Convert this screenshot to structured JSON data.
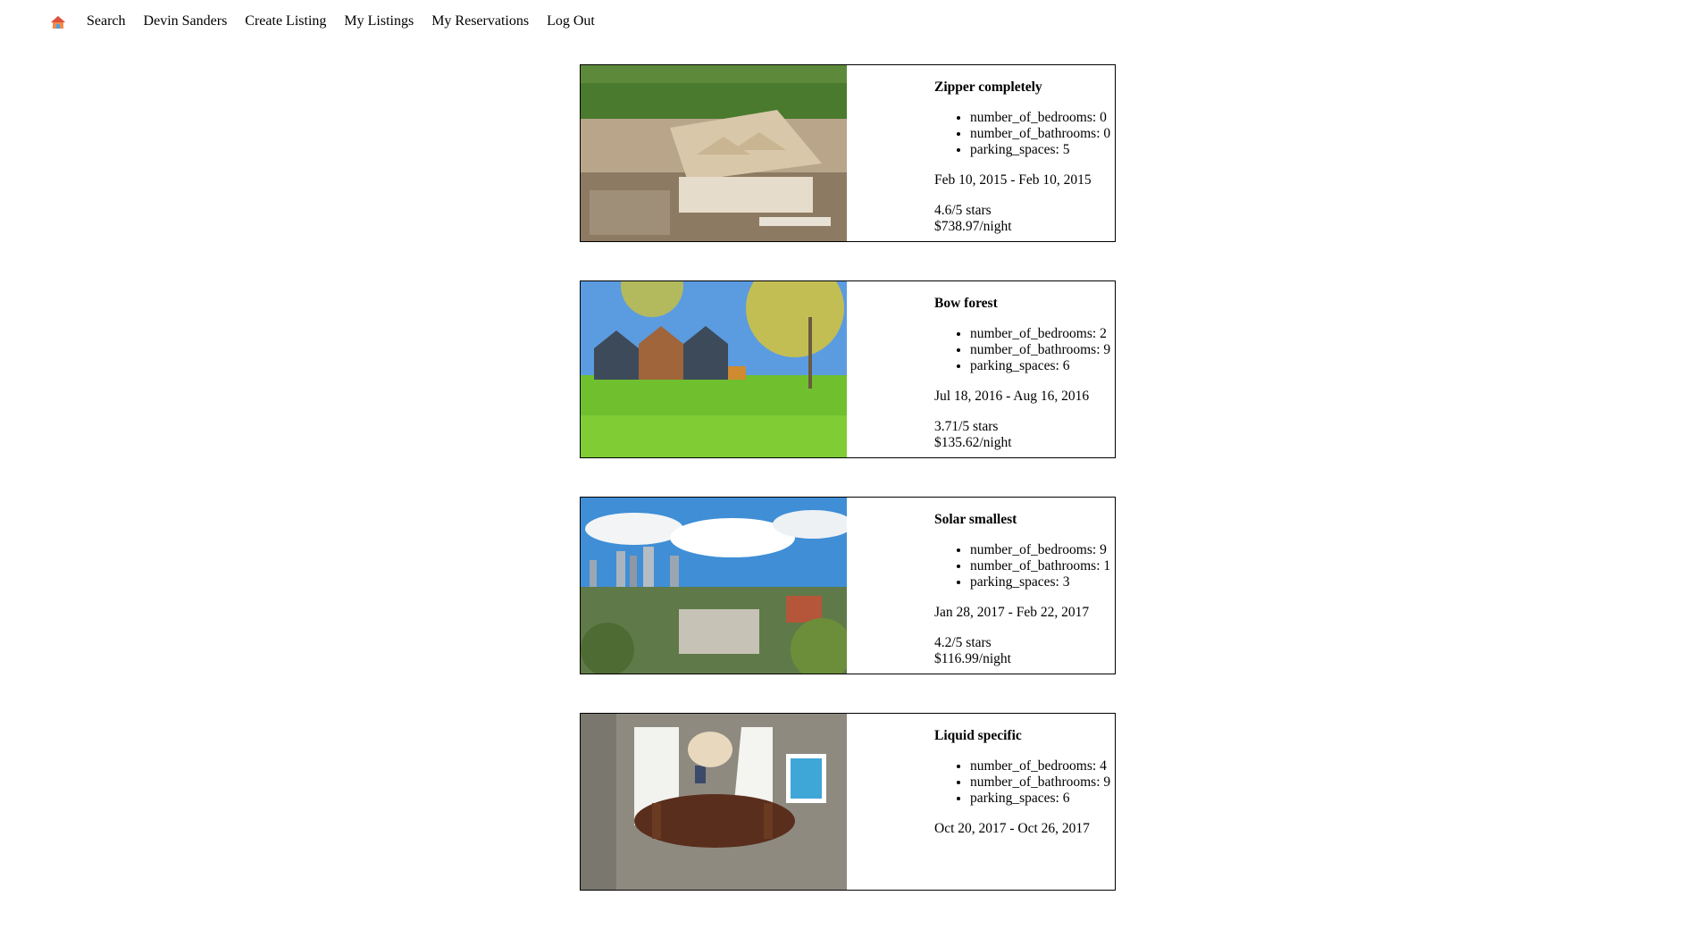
{
  "nav": {
    "home_icon": "home-icon",
    "links": [
      "Search",
      "Devin Sanders",
      "Create Listing",
      "My Listings",
      "My Reservations",
      "Log Out"
    ]
  },
  "listings": [
    {
      "title": "Zipper completely",
      "features": [
        "number_of_bedrooms: 0",
        "number_of_bathrooms: 0",
        "parking_spaces: 5"
      ],
      "dates": "Feb 10, 2015 - Feb 10, 2015",
      "rating": "4.6/5 stars",
      "price": "$738.97/night",
      "image": "house-under-construction-photo"
    },
    {
      "title": "Bow forest",
      "features": [
        "number_of_bedrooms: 2",
        "number_of_bathrooms: 9",
        "parking_spaces: 6"
      ],
      "dates": "Jul 18, 2016 - Aug 16, 2016",
      "rating": "3.71/5 stars",
      "price": "$135.62/night",
      "image": "modern-houses-in-park-photo"
    },
    {
      "title": "Solar smallest",
      "features": [
        "number_of_bedrooms: 9",
        "number_of_bathrooms: 1",
        "parking_spaces: 3"
      ],
      "dates": "Jan 28, 2017 - Feb 22, 2017",
      "rating": "4.2/5 stars",
      "price": "$116.99/night",
      "image": "city-skyline-photo"
    },
    {
      "title": "Liquid specific",
      "features": [
        "number_of_bedrooms: 4",
        "number_of_bathrooms: 9",
        "parking_spaces: 6"
      ],
      "dates": "Oct 20, 2017 - Oct 26, 2017",
      "rating": "",
      "price": "",
      "image": "dining-room-interior-photo"
    }
  ]
}
